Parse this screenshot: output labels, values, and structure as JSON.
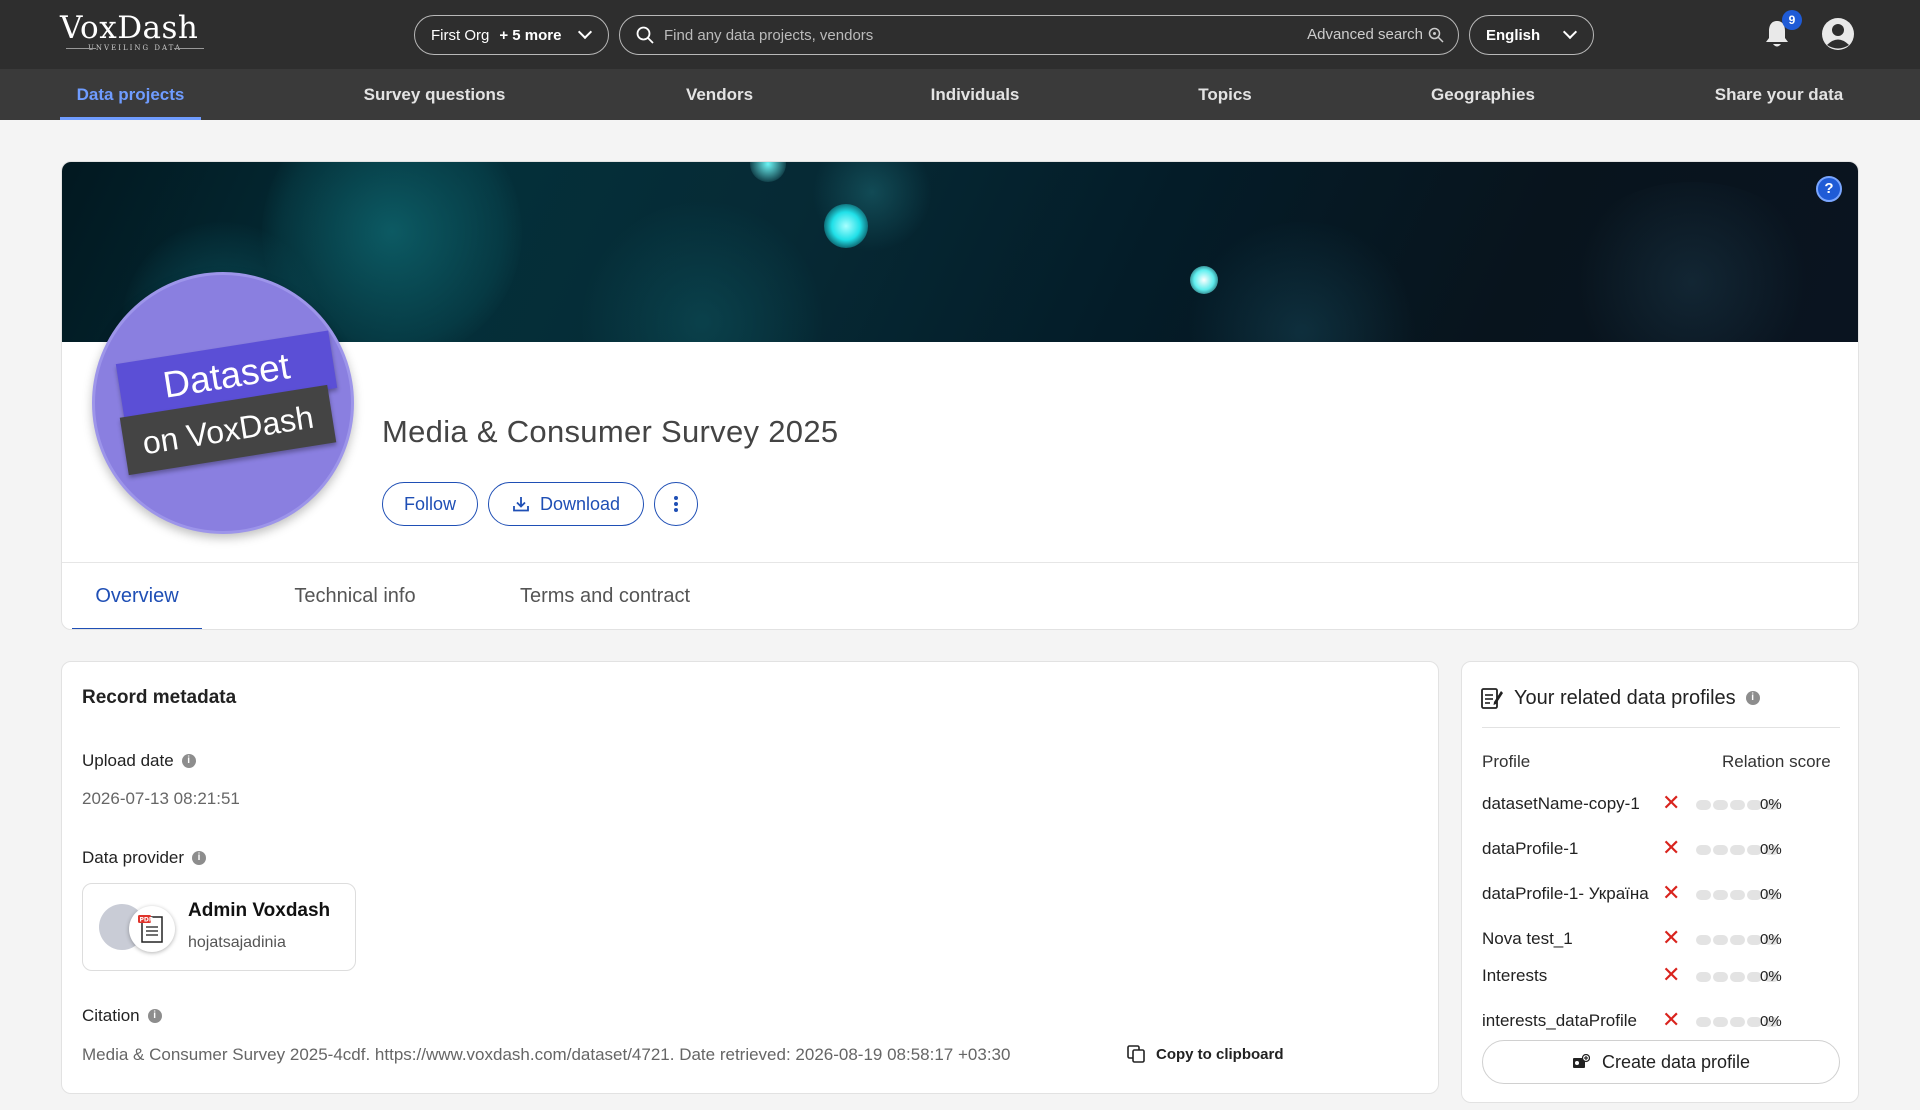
{
  "brand": {
    "name": "VoxDash",
    "tagline": "UNVEILING DATA"
  },
  "topbar": {
    "org": "First Org",
    "org_more": "+ 5 more",
    "search_placeholder": "Find any data projects, vendors",
    "advanced_search": "Advanced search",
    "language": "English",
    "notification_count": "9"
  },
  "nav": {
    "items": [
      {
        "label": "Data projects"
      },
      {
        "label": "Survey questions"
      },
      {
        "label": "Vendors"
      },
      {
        "label": "Individuals"
      },
      {
        "label": "Topics"
      },
      {
        "label": "Geographies"
      },
      {
        "label": "Share your data"
      }
    ]
  },
  "dataset": {
    "badge_line1": "Dataset",
    "badge_line2": "on VoxDash",
    "title": "Media & Consumer Survey 2025",
    "follow": "Follow",
    "download": "Download",
    "tabs": [
      "Overview",
      "Technical info",
      "Terms and contract"
    ]
  },
  "metadata": {
    "heading": "Record metadata",
    "upload_label": "Upload date",
    "upload_value": "2026-07-13 08:21:51",
    "provider_label": "Data provider",
    "provider_name": "Admin Voxdash",
    "provider_user": "hojatsajadinia",
    "citation_label": "Citation",
    "citation_value": "Media & Consumer Survey 2025-4cdf. https://www.voxdash.com/dataset/4721. Date retrieved: 2026-08-19 08:58:17 +03:30",
    "copy_label": "Copy to clipboard"
  },
  "related": {
    "heading": "Your related data profiles",
    "col_profile": "Profile",
    "col_score": "Relation score",
    "rows": [
      {
        "name": "datasetName-copy-1",
        "score": "0%"
      },
      {
        "name": "dataProfile-1",
        "score": "0%"
      },
      {
        "name": "dataProfile-1- Україна",
        "score": "0%"
      },
      {
        "name": "Nova test_1",
        "score": "0%"
      },
      {
        "name": "Interests",
        "score": "0%"
      },
      {
        "name": "interests_dataProfile",
        "score": "0%"
      }
    ],
    "create_label": "Create data profile"
  },
  "colors": {
    "accent": "#1f4fb5",
    "nav_active": "#6f9cff",
    "remove": "#d9231d"
  }
}
